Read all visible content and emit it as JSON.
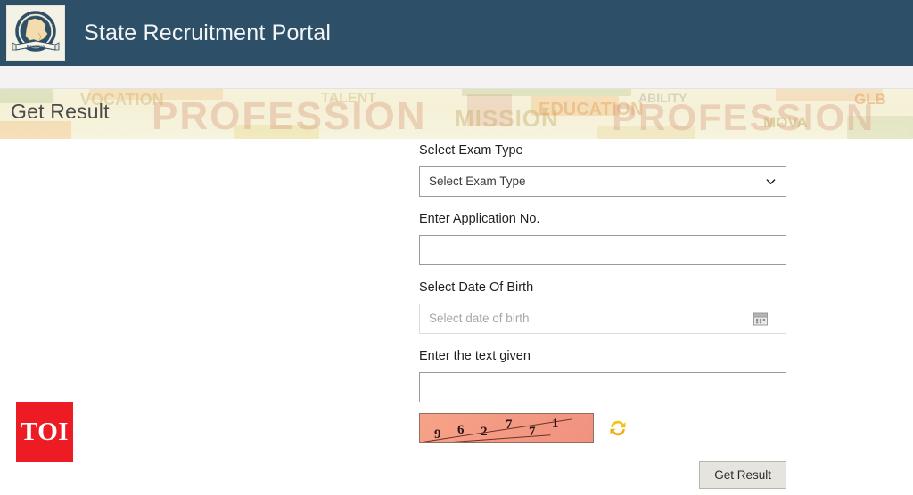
{
  "header": {
    "title": "State Recruitment Portal",
    "logo_alt": "state-emblem-logo",
    "background_color": "#2d5068"
  },
  "banner": {
    "title": "Get Result",
    "background_texture_words": [
      "PROFESSION",
      "PROFESSION",
      "MISSION",
      "EDUCATION",
      "VOCATION",
      "TALENT",
      "GLB",
      "MOVA",
      "ABILITY"
    ],
    "background_color": "#f5f1d8"
  },
  "form": {
    "exam_type": {
      "label": "Select Exam Type",
      "selected": "Select Exam Type",
      "options": [
        "Select Exam Type"
      ]
    },
    "application_no": {
      "label": "Enter Application No.",
      "value": "",
      "placeholder": ""
    },
    "date_of_birth": {
      "label": "Select Date Of Birth",
      "value": "",
      "placeholder": "Select date of birth",
      "icon": "calendar-icon"
    },
    "captcha_text": {
      "label": "Enter the text given",
      "value": "",
      "placeholder": ""
    },
    "captcha": {
      "code": "962771",
      "digits": [
        "9",
        "6",
        "2",
        "7",
        "7",
        "1"
      ],
      "refresh_icon": "refresh-icon",
      "background_color": "#f49a84"
    },
    "submit": {
      "label": "Get Result"
    }
  },
  "watermark": {
    "label": "TOI",
    "color": "#ed1b24"
  }
}
